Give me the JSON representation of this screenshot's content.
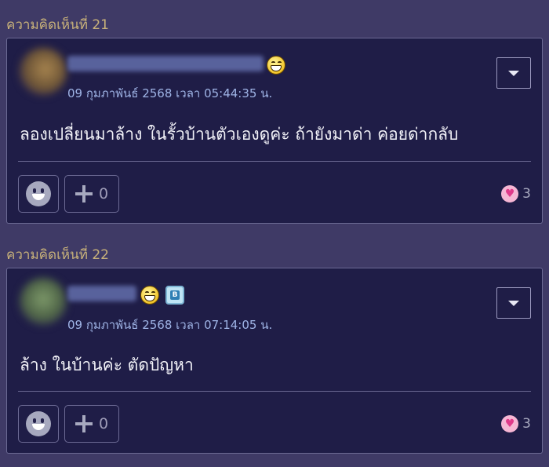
{
  "comments": [
    {
      "label": "ความคิดเห็นที่ 21",
      "timestamp": "09 กุมภาพันธ์ 2568 เวลา 05:44:35 น.",
      "message": "ลองเปลี่ยนมาล้าง ในรั้วบ้านตัวเองดูค่ะ ถ้ายังมาด่า ค่อยด่ากลับ",
      "plus_count": "0",
      "heart_count": "3"
    },
    {
      "label": "ความคิดเห็นที่ 22",
      "timestamp": "09 กุมภาพันธ์ 2568 เวลา 07:14:05 น.",
      "message": "ล้าง ในบ้านค่ะ ตัดปัญหา",
      "plus_count": "0",
      "heart_count": "3"
    }
  ],
  "icons": {
    "menu": "chevron-down-icon",
    "emotion": "smile-icon",
    "plus": "plus-icon",
    "heart": "heart-icon",
    "member_badge": "bloggang-badge-icon"
  },
  "colors": {
    "page_bg": "#3f3a66",
    "card_bg": "#1f1d47",
    "label": "#c9b27a",
    "timestamp": "#9fb4e6",
    "heart": "#e03a8a"
  }
}
